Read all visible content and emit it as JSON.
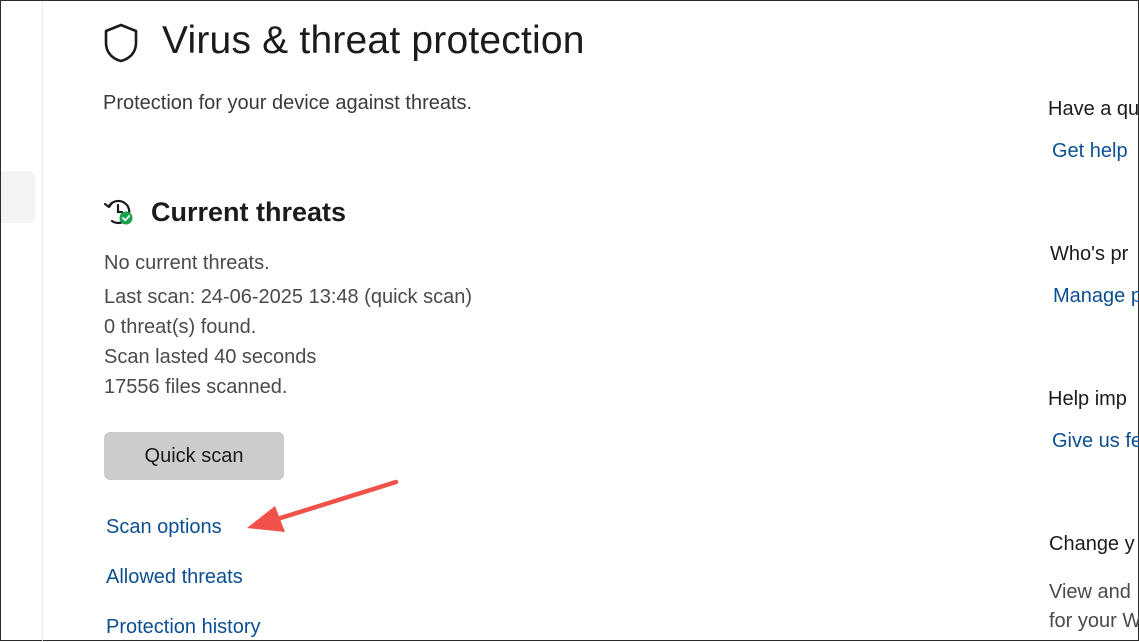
{
  "page": {
    "title": "Virus & threat protection",
    "subtitle": "Protection for your device against threats.",
    "title_icon": "shield-icon"
  },
  "current_threats": {
    "heading": "Current threats",
    "icon": "clock-check-icon",
    "status": "No current threats.",
    "last_scan": "Last scan: 24-06-2025 13:48 (quick scan)",
    "threats_found": "0 threat(s) found.",
    "duration": "Scan lasted 40 seconds",
    "files_scanned": "17556 files scanned.",
    "quick_scan_label": "Quick scan",
    "links": {
      "scan_options": "Scan options",
      "allowed_threats": "Allowed threats",
      "protection_history": "Protection history"
    }
  },
  "right_panel": {
    "question_heading": "Have a qu",
    "get_help": "Get help",
    "whos_heading": "Who's pr",
    "manage_link": "Manage p",
    "help_improve_heading": "Help imp",
    "feedback_link": "Give us fe",
    "change_heading": "Change y",
    "view_line1": "View and",
    "view_line2": "for your W"
  },
  "colors": {
    "link": "#0b4f91",
    "button_bg": "#cccccc",
    "check_green": "#16a34a",
    "annotation_arrow": "#f0524a"
  }
}
